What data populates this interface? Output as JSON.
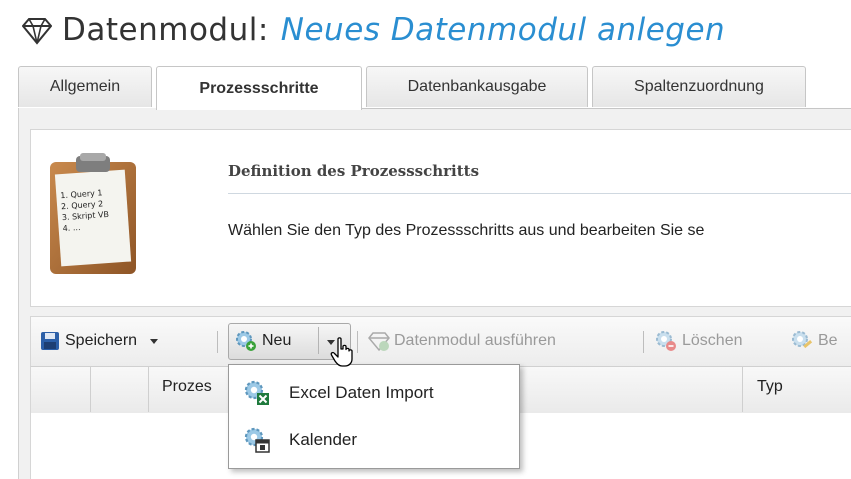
{
  "header": {
    "icon": "diamond-gem-icon",
    "title_main": "Datenmodul:",
    "title_sub": "Neues Datenmodul anlegen"
  },
  "tabs": [
    {
      "label": "Allgemein",
      "active": false
    },
    {
      "label": "Prozessschritte",
      "active": true
    },
    {
      "label": "Datenbankausgabe",
      "active": false
    },
    {
      "label": "Spaltenzuordnung",
      "active": false
    }
  ],
  "definition": {
    "icon": "clipboard-icon",
    "clipboard_lines": [
      "1. Query 1",
      "2. Query 2",
      "3. Skript VB",
      "4. ..."
    ],
    "title": "Definition des Prozessschritts",
    "text": "Wählen Sie den Typ des Prozessschritts aus und bearbeiten Sie se"
  },
  "toolbar": {
    "save_label": "Speichern",
    "new_label": "Neu",
    "run_label": "Datenmodul ausführen",
    "delete_label": "Löschen",
    "edit_label": "Be"
  },
  "grid": {
    "columns": [
      "Prozes",
      "Typ"
    ]
  },
  "new_menu": {
    "items": [
      {
        "label": "Excel Daten Import",
        "icon": "excel-gear-icon"
      },
      {
        "label": "Kalender",
        "icon": "calendar-gear-icon"
      }
    ]
  },
  "colors": {
    "accent": "#2a8ed1",
    "panel_bg": "#f1f1f1",
    "disabled_text": "#9a9a9a"
  }
}
